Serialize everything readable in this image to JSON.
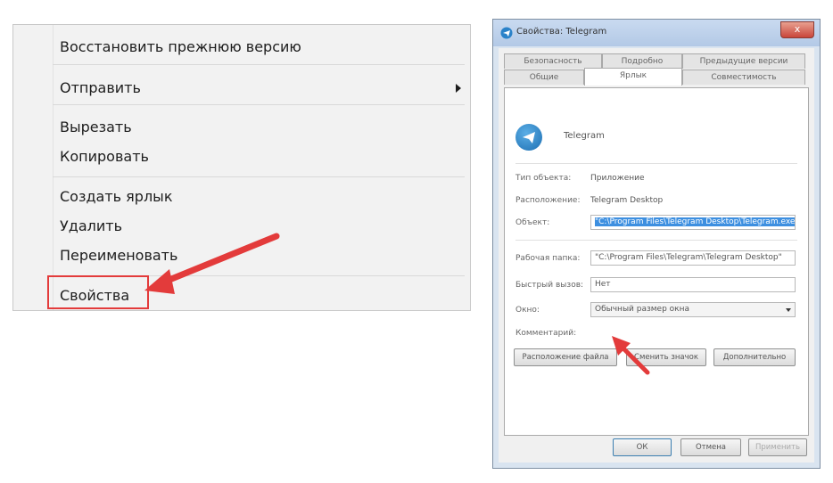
{
  "context_menu": {
    "items": [
      {
        "label": "Восстановить прежнюю версию"
      },
      {
        "label": "Отправить",
        "has_submenu": true
      },
      {
        "label": "Вырезать"
      },
      {
        "label": "Копировать"
      },
      {
        "label": "Создать ярлык"
      },
      {
        "label": "Удалить"
      },
      {
        "label": "Переименовать"
      },
      {
        "label": "Свойства",
        "highlighted": true
      }
    ]
  },
  "dialog": {
    "title": "Свойства: Telegram",
    "close_symbol": "x",
    "tabs_row1": [
      "Безопасность",
      "Подробно",
      "Предыдущие версии"
    ],
    "tabs_row2": [
      "Общие",
      "Ярлык",
      "Совместимость"
    ],
    "active_tab": "Ярлык",
    "app_name": "Telegram",
    "type_label": "Тип объекта:",
    "type_value": "Приложение",
    "location_label": "Расположение:",
    "location_value": "Telegram Desktop",
    "target_label": "Объект:",
    "target_value": "\"C:\\Program Files\\Telegram Desktop\\Telegram.exe\"",
    "start_in_label": "Рабочая папка:",
    "start_in_value": "\"C:\\Program Files\\Telegram\\Telegram Desktop\"",
    "shortcut_key_label": "Быстрый вызов:",
    "shortcut_key_value": "Нет",
    "window_label": "Окно:",
    "window_value": "Обычный размер окна",
    "comment_label": "Комментарий:",
    "buttons": {
      "open_location": "Расположение файла",
      "change_icon": "Сменить значок",
      "advanced": "Дополнительно"
    },
    "footer": {
      "ok": "ОК",
      "cancel": "Отмена",
      "apply": "Применить"
    }
  },
  "colors": {
    "annotation_red": "#e33b3b",
    "selection_blue": "#3d8fe0"
  }
}
